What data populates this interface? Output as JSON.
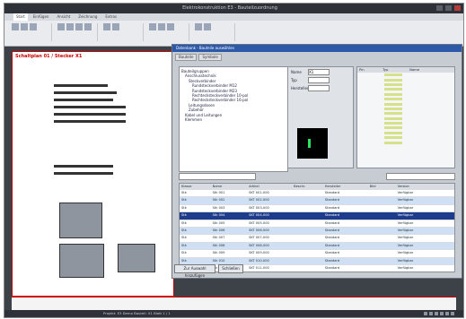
{
  "app": {
    "title": "Elektrokonstruktion E3 - Bauteilzuordnung",
    "ribbon_tabs": [
      "Start",
      "Einfügen",
      "Ansicht",
      "Zeichnung",
      "Extras"
    ]
  },
  "sheet": {
    "header": "Schaltplan 01 / Stecker X1"
  },
  "dialog": {
    "title": "Datenbank - Bauteile auswählen",
    "tabs": [
      "Bauteile",
      "Symbole"
    ],
    "tree": [
      "Bauteilgruppen",
      "Anschlusstechnik",
      "Steckverbinder",
      "Rundsteckverbinder M12",
      "Rundsteckverbinder M23",
      "Rechtecksteckverbinder 10-pol",
      "Rechtecksteckverbinder 16-pol",
      "Leitungsdosen",
      "Zubehör",
      "Kabel und Leitungen",
      "Klemmen"
    ],
    "field_labels": [
      "Name",
      "Typ",
      "Hersteller"
    ],
    "field_values": [
      "X1",
      "",
      ""
    ],
    "list_headers": [
      "Pin",
      "Typ",
      "Name"
    ],
    "list_count": 15,
    "search_value": "",
    "grid_headers": [
      "Klasse",
      "Name",
      "Artikel",
      "Beschr.",
      "Hersteller",
      "Bild",
      "Version"
    ],
    "grid_rows": [
      [
        "Stk",
        "Stk 001",
        "SKT 001-000",
        "",
        "Standard",
        "",
        "Verfügbar"
      ],
      [
        "Stk",
        "Stk 002",
        "SKT 002-000",
        "",
        "Standard",
        "",
        "Verfügbar"
      ],
      [
        "Stk",
        "Stk 003",
        "SKT 003-000",
        "",
        "Standard",
        "",
        "Verfügbar"
      ],
      [
        "Stk",
        "Stk 004",
        "SKT 004-000",
        "",
        "Standard",
        "",
        "Verfügbar"
      ],
      [
        "Stk",
        "Stk 005",
        "SKT 005-000",
        "",
        "Standard",
        "",
        "Verfügbar"
      ],
      [
        "Stk",
        "Stk 006",
        "SKT 006-000",
        "",
        "Standard",
        "",
        "Verfügbar"
      ],
      [
        "Stk",
        "Stk 007",
        "SKT 007-000",
        "",
        "Standard",
        "",
        "Verfügbar"
      ],
      [
        "Stk",
        "Stk 008",
        "SKT 008-000",
        "",
        "Standard",
        "",
        "Verfügbar"
      ],
      [
        "Stk",
        "Stk 009",
        "SKT 009-000",
        "",
        "Standard",
        "",
        "Verfügbar"
      ],
      [
        "Stk",
        "Stk 010",
        "SKT 010-000",
        "",
        "Standard",
        "",
        "Verfügbar"
      ],
      [
        "Stk",
        "Stk 011",
        "SKT 011-000",
        "",
        "Standard",
        "",
        "Verfügbar"
      ],
      [
        "Stk",
        "Stk 012",
        "SKT 012-000",
        "",
        "Standard",
        "",
        "Verfügbar"
      ]
    ],
    "selected_row": 3,
    "buttons": [
      "Zur Auswahl hinzufügen",
      "Schließen"
    ]
  },
  "status": {
    "text": "Projekt: E3 Demo    Bauteil: X1    Blatt 1 / 1"
  },
  "colors": {
    "accent": "#2d5aa8",
    "selection": "#1e3c8c",
    "sheet_border": "#cc0000"
  }
}
